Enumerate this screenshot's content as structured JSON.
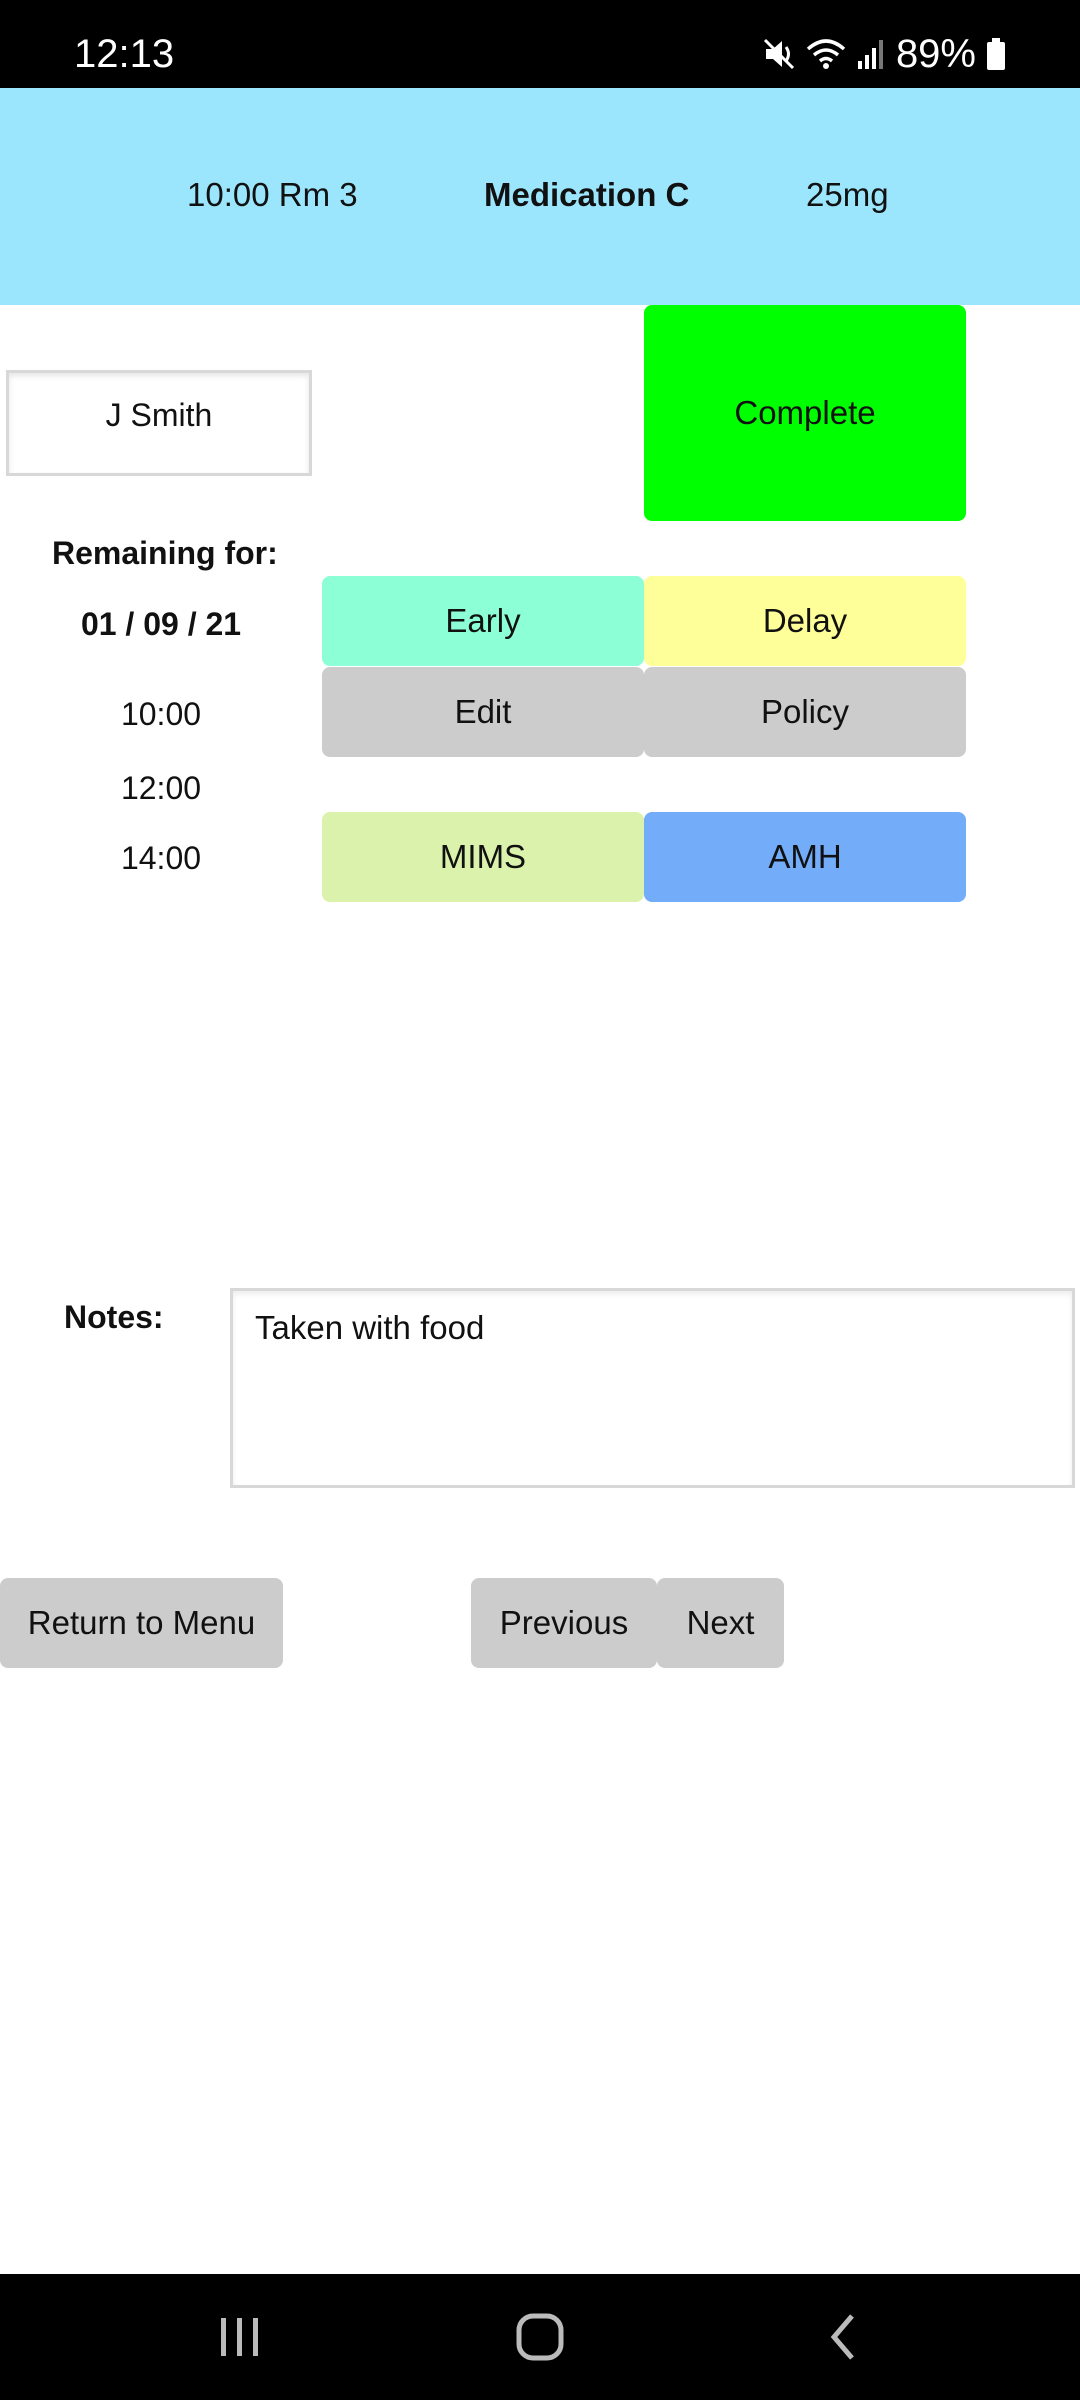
{
  "status_bar": {
    "time": "12:13",
    "battery": "89%",
    "icons": [
      "mute-icon",
      "wifi-icon",
      "signal-icon",
      "battery-icon"
    ]
  },
  "header": {
    "time_room": "10:00 Rm 3",
    "medication": "Medication C",
    "dose": "25mg",
    "background_color": "#9be6fc"
  },
  "patient": {
    "name": "J Smith"
  },
  "buttons": {
    "complete": "Complete",
    "early": "Early",
    "delay": "Delay",
    "edit": "Edit",
    "policy": "Policy",
    "mims": "MIMS",
    "amh": "AMH"
  },
  "colors": {
    "complete": "#00ff00",
    "early": "#8cffd6",
    "delay": "#ffff99",
    "edit": "#cccccc",
    "policy": "#cccccc",
    "mims": "#dbf2ad",
    "amh": "#73adfa"
  },
  "remaining": {
    "label": "Remaining for:",
    "date": "01 / 09 / 21",
    "times": [
      "10:00",
      "12:00",
      "14:00"
    ]
  },
  "notes": {
    "label": "Notes:",
    "value": "Taken with food"
  },
  "navigation": {
    "return": "Return to Menu",
    "previous": "Previous",
    "next": "Next"
  },
  "system_nav": {
    "icons": [
      "recents-icon",
      "home-icon",
      "back-icon"
    ]
  }
}
